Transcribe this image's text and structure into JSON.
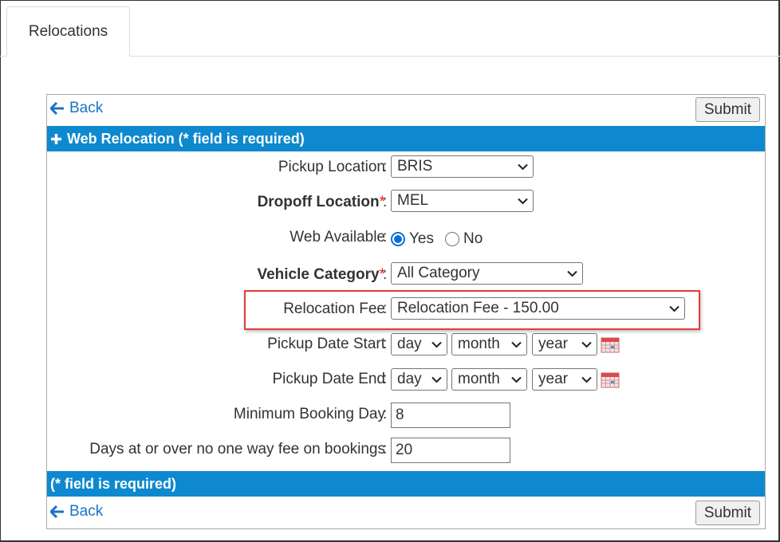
{
  "tabs": [
    {
      "label": "Relocations"
    }
  ],
  "nav": {
    "back_label": "Back",
    "submit_label": "Submit"
  },
  "header_bar": {
    "title": "Web Relocation (* field is required)"
  },
  "footer_bar": {
    "title": "(* field is required)"
  },
  "form": {
    "colon": ":",
    "required_mark": "*",
    "pickup_location": {
      "label": "Pickup Location",
      "value": "BRIS"
    },
    "dropoff_location": {
      "label": "Dropoff Location",
      "value": "MEL",
      "required": true
    },
    "web_available": {
      "label": "Web Available",
      "options": [
        "Yes",
        "No"
      ],
      "selected": "Yes"
    },
    "vehicle_category": {
      "label": "Vehicle Category",
      "value": "All Category",
      "required": true
    },
    "relocation_fee": {
      "label": "Relocation Fee",
      "value": "Relocation Fee - 150.00"
    },
    "pickup_date_start": {
      "label": "Pickup Date Start",
      "day": "day",
      "month": "month",
      "year": "year"
    },
    "pickup_date_end": {
      "label": "Pickup Date End",
      "day": "day",
      "month": "month",
      "year": "year"
    },
    "minimum_booking_day": {
      "label": "Minimum Booking Day",
      "value": "8"
    },
    "one_way_fee_days": {
      "label": "Days at or over no one way fee on bookings",
      "value": "20"
    }
  },
  "colors": {
    "accent_bar": "#0e89cf",
    "link": "#1a73c6",
    "required": "#e01818",
    "highlight": "#e43b3b"
  },
  "icons": [
    "arrow-left-icon",
    "plus-icon",
    "chevron-down-icon",
    "calendar-icon"
  ]
}
